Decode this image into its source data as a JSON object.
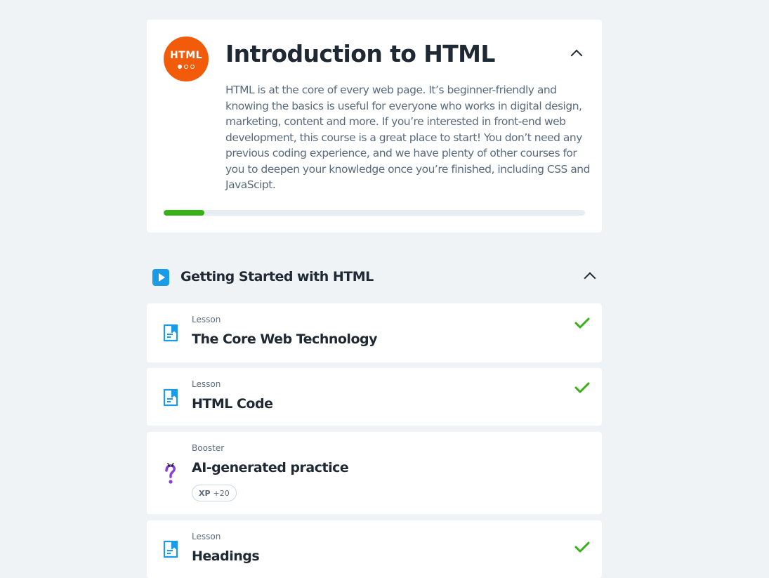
{
  "course": {
    "logo_text": "HTML",
    "title": "Introduction to HTML",
    "description": "HTML is at the core of every web page. It’s beginner-friendly and knowing the basics is useful for everyone who works in digital design, marketing, content and more. If you’re interested in front-end web development, this course is a great place to start! You don’t need any previous coding experience, and we have plenty of other courses for you to deepen your knowledge once you’re finished, including CSS and JavaScipt.",
    "progress_fraction": 0.097,
    "progress_color": "#38b118",
    "logo_color": "#f25b0a"
  },
  "section": {
    "title": "Getting Started with HTML",
    "icon": "play-icon",
    "icon_color": "#1a9be8"
  },
  "items": [
    {
      "type": "Lesson",
      "title": "The Core Web Technology",
      "completed": true
    },
    {
      "type": "Lesson",
      "title": "HTML Code",
      "completed": true
    },
    {
      "type": "Booster",
      "title": "AI-generated practice",
      "completed": false,
      "xp_label": "XP",
      "xp_value": "+20"
    },
    {
      "type": "Lesson",
      "title": "Headings",
      "completed": true
    }
  ],
  "colors": {
    "background": "#f0f3f6",
    "check": "#38b118",
    "lesson_icon": "#1a9be8",
    "booster_icon": "#8a3fd8"
  }
}
